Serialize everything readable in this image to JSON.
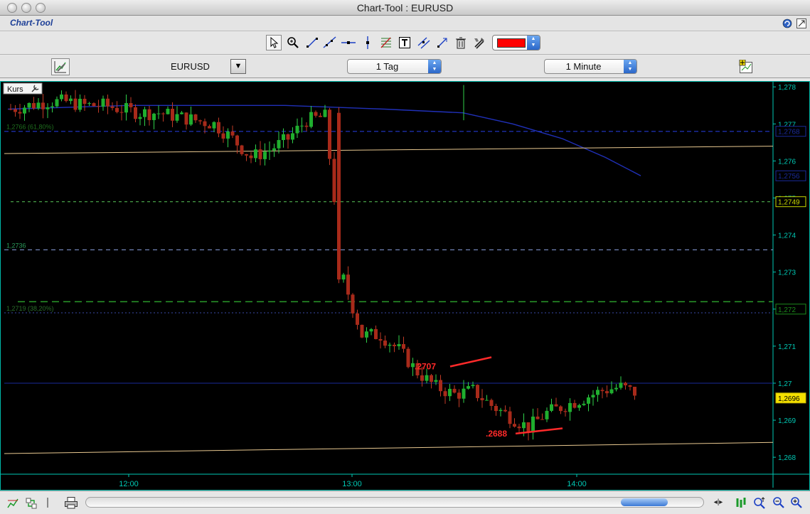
{
  "window": {
    "title": "Chart-Tool : EURUSD"
  },
  "app": {
    "label": "Chart-Tool"
  },
  "toolbar": {
    "tools": [
      "pointer-icon",
      "zoom-icon",
      "trend-line-icon",
      "ray-line-icon",
      "horizontal-line-icon",
      "vertical-line-icon",
      "fibonacci-icon",
      "text-icon",
      "parallel-lines-icon",
      "arrow-line-icon",
      "trash-icon",
      "tools-icon"
    ],
    "line_color": "#ff0000"
  },
  "symbolbar": {
    "symbol": "EURUSD",
    "period": "1 Tag",
    "interval": "1 Minute"
  },
  "chart": {
    "indicator_label": "Kurs",
    "accent": "#00c8b4",
    "price_axis": {
      "ticks": [
        "1,278",
        "1,277",
        "1,276",
        "1,275",
        "1,274",
        "1,273",
        "1,272",
        "1,271",
        "1,27",
        "1,269",
        "1,268"
      ],
      "tags": [
        {
          "text": "1,2768",
          "bg": "#000000",
          "fg": "#1a2a9a"
        },
        {
          "text": "1,2756",
          "bg": "#000000",
          "fg": "#1a2a9a"
        },
        {
          "text": "1,2749",
          "bg": "#000000",
          "fg": "#c8d800"
        },
        {
          "text": "1,272",
          "bg": "#000000",
          "fg": "#1c8a1c"
        },
        {
          "text": "1,2696",
          "bg": "#f5e000",
          "fg": "#000000"
        }
      ]
    },
    "time_axis": {
      "ticks": [
        "12:00",
        "13:00",
        "14:00"
      ]
    },
    "level_labels": [
      "1,2766 (61,80%)",
      "1,2736",
      "1,2719 (38,20%)"
    ],
    "annotations": [
      ".2707",
      ".2688"
    ]
  },
  "chart_data": {
    "type": "line",
    "title": "",
    "xlabel": "",
    "ylabel": "",
    "ylim": [
      1.2676,
      1.2781
    ],
    "x_ticks": [
      "12:00",
      "13:00",
      "14:00"
    ],
    "series": [
      {
        "values": [
          1.2774,
          1.2775,
          1.2776,
          1.2776,
          1.2775,
          1.2775,
          1.2774,
          1.2773,
          1.2773,
          1.2772,
          1.2771,
          1.277,
          1.2766,
          1.2761,
          1.2763,
          1.2766,
          1.2771,
          1.2772,
          1.2728,
          1.2713,
          1.2713,
          1.2709,
          1.2703,
          1.2699,
          1.2697,
          1.2698,
          1.2694,
          1.2691,
          1.2688,
          1.2692,
          1.2694,
          1.2696,
          1.2698,
          1.2699,
          1.2697
        ]
      },
      {
        "values": [
          1.2775,
          1.277
        ]
      },
      {
        "values": [
          1.2762,
          1.2764
        ]
      },
      {
        "values": [
          1.2681,
          1.2684
        ]
      }
    ],
    "horizontal_lines": [
      1.2768,
      1.2749,
      1.2736,
      1.2722,
      1.2719,
      1.27
    ]
  }
}
